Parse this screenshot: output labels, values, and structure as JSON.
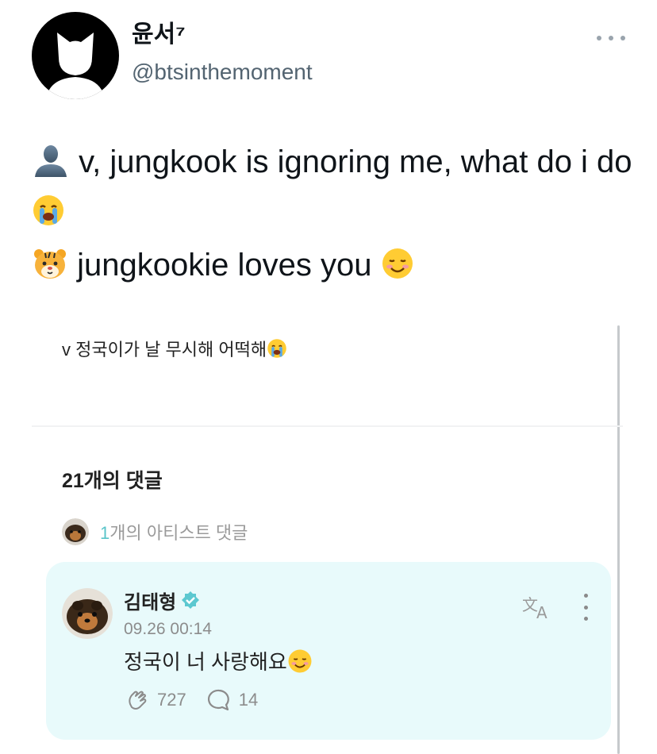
{
  "author": {
    "display_name": "윤서⁷",
    "handle": "@btsinthemoment"
  },
  "tweet": {
    "line1_text": "v, jungkook is ignoring me, what do i do",
    "line1_icon": "bust-in-silhouette-emoji",
    "line1_end_icon": "loudly-crying-face-emoji",
    "line2_text": "jungkookie loves you",
    "line2_icon": "tiger-face-emoji",
    "line2_end_icon": "smiling-face-emoji"
  },
  "embed": {
    "post_text": "v 정국이가 날 무시해 어떡해",
    "post_end_icon": "loudly-crying-face-emoji",
    "comments_title": "21개의 댓글",
    "artist_comments_count": "1",
    "artist_comments_label": "개의 아티스트 댓글",
    "comment": {
      "name": "김태형",
      "timestamp": "09.26 00:14",
      "text": "정국이 너 사랑해요",
      "text_end_icon": "smiling-face-emoji",
      "likes": "727",
      "replies": "14"
    }
  },
  "colors": {
    "text": "#0f1419",
    "handle": "#536471",
    "card_bg": "#e8fafb",
    "accent_teal": "#59c4c9",
    "muted": "#8c8c8c"
  }
}
